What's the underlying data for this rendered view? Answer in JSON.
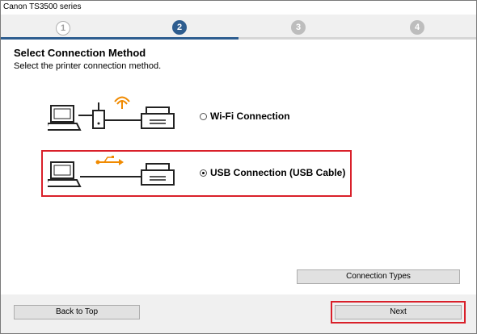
{
  "window": {
    "title": "Canon TS3500 series"
  },
  "steps": [
    {
      "label": "1",
      "state": "done"
    },
    {
      "label": "2",
      "state": "active"
    },
    {
      "label": "3",
      "state": "todo"
    },
    {
      "label": "4",
      "state": "todo"
    }
  ],
  "main": {
    "heading": "Select Connection Method",
    "subtext": "Select the printer connection method.",
    "options": [
      {
        "label": "Wi-Fi Connection",
        "selected": false,
        "icon": "wifi-icon"
      },
      {
        "label": "USB Connection (USB Cable)",
        "selected": true,
        "icon": "usb-icon"
      }
    ],
    "connection_types_label": "Connection Types"
  },
  "footer": {
    "back_label": "Back to Top",
    "next_label": "Next"
  },
  "colors": {
    "accent": "#2e5d8f",
    "highlight": "#d9202a",
    "wifi_usb_icon": "#f08a00"
  }
}
